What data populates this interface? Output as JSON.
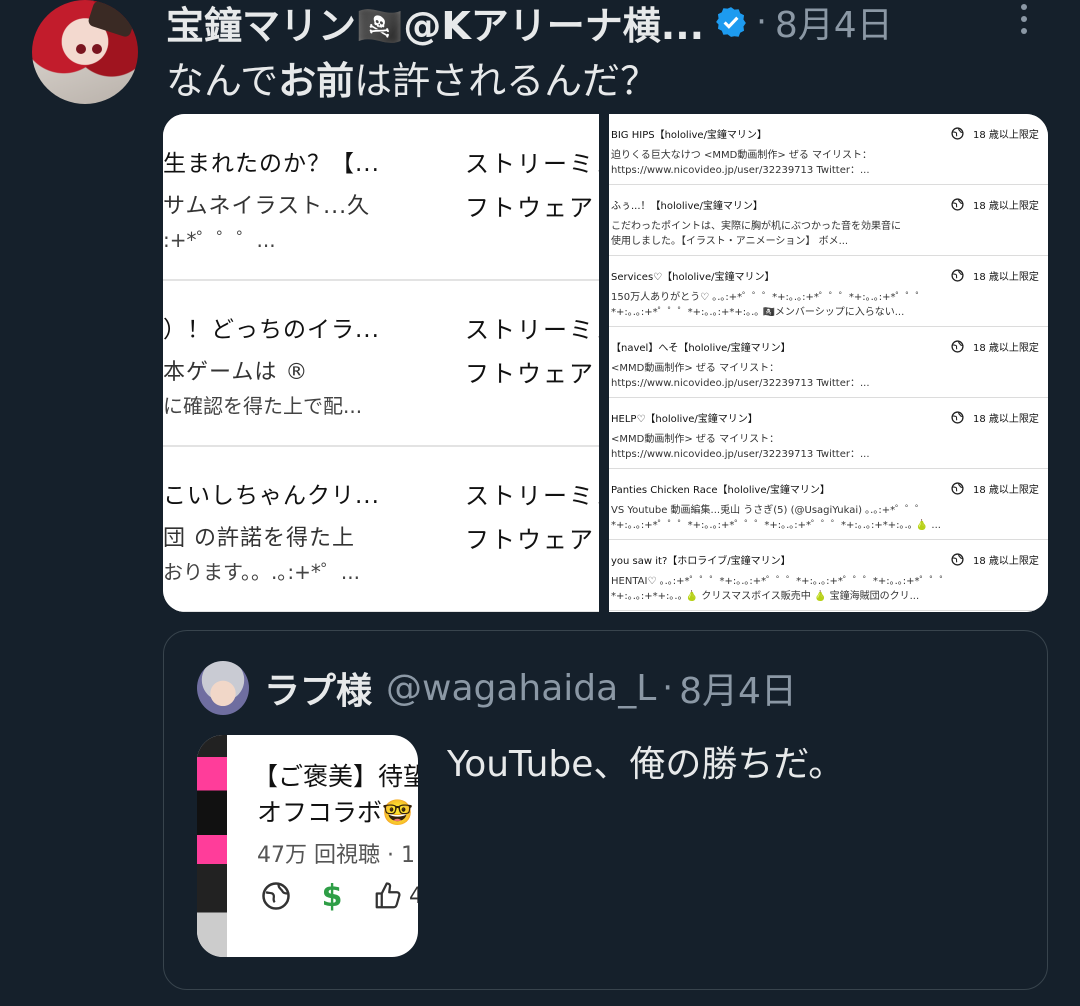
{
  "tweet": {
    "author_name": "宝鐘マリン🏴‍☠️@Kアリーナ横...",
    "date": "8月4日",
    "text_pre": "なんで",
    "text_bold": "お前",
    "text_post": "は許されるんだ？"
  },
  "media_left": [
    {
      "title": "生まれたのか？【...",
      "sub": "サムネイラスト...久",
      "sub2": ":+*゜゜゜...",
      "cat1": "ストリーミン",
      "cat2": "フトウェア"
    },
    {
      "title": "）！どっちのイラ...",
      "sub": "本ゲームは ®",
      "sub2": "に確認を得た上で配...",
      "cat1": "ストリーミン",
      "cat2": "フトウェア"
    },
    {
      "title": "こいしちゃんクリ...",
      "sub": "団 の許諾を得た上",
      "sub2": "おります。。.｡:+*゜...",
      "cat1": "ストリーミン",
      "cat2": "フトウェア"
    }
  ],
  "media_right": [
    {
      "title": "BIG HIPS【hololive/宝鐘マリン】",
      "d1": "迫りくる巨大なけつ <MMD動画制作> ぜる マイリスト：",
      "d2": "https://www.nicovideo.jp/user/32239713 Twitter：...",
      "badge": "18 歳以上限定"
    },
    {
      "title": "ふぅ...！【hololive/宝鐘マリン】",
      "d1": "こだわったポイントは、実際に胸が机にぶつかった音を効果音に",
      "d2": "使用しました。【イラスト・アニメーション】 ボメ...",
      "badge": "18 歳以上限定"
    },
    {
      "title": "Services♡【hololive/宝鐘マリン】",
      "d1": "150万人ありがとう♡ ｡.｡:+*゜゜゜*+:｡.｡:+*゜゜゜*+:｡.｡:+*゜゜゜",
      "d2": "*+:｡.｡:+*゜゜゜*+:｡.｡:+*+:｡.｡ 🏴‍☠️メンバーシップに入らない...",
      "badge": "18 歳以上限定"
    },
    {
      "title": "【navel】へそ【hololive/宝鐘マリン】",
      "d1": "<MMD動画制作> ぜる マイリスト：",
      "d2": "https://www.nicovideo.jp/user/32239713 Twitter：...",
      "badge": "18 歳以上限定"
    },
    {
      "title": "HELP♡【hololive/宝鐘マリン】",
      "d1": "<MMD動画制作> ぜる マイリスト：",
      "d2": "https://www.nicovideo.jp/user/32239713 Twitter：...",
      "badge": "18 歳以上限定"
    },
    {
      "title": "Panties Chicken Race【hololive/宝鐘マリン】",
      "d1": "VS Youtube 動画編集...兎山 うさぎ(5) (@UsagiYukai) ｡.｡:+*゜゜゜",
      "d2": "*+:｡.｡:+*゜゜゜*+:｡.｡:+*゜゜゜*+:｡.｡:+*゜゜゜*+:｡.｡:+*+:｡.｡ 🍐 ...",
      "badge": "18 歳以上限定"
    },
    {
      "title": "you saw it?【ホロライブ/宝鐘マリン】",
      "d1": "HENTAI♡ ｡.｡:+*゜゜゜*+:｡.｡:+*゜゜゜*+:｡.｡:+*゜゜゜*+:｡.｡:+*゜゜゜",
      "d2": "*+:｡.｡:+*+:｡.｡ 🍐 クリスマスボイス販売中 🍐 宝鐘海賊団のクリ...",
      "badge": "18 歳以上限定"
    }
  ],
  "quote": {
    "name": "ラプ様",
    "handle": "@wagahaida_L",
    "date": "8月4日",
    "text": "YouTube、俺の勝ちだ。",
    "thumb_title1": "【ご褒美】待望",
    "thumb_title2": "オフコラボ🤓",
    "thumb_views": "47万 回視聴 · 1",
    "thumb_count": "4"
  },
  "icons": {
    "verified": "verified-badge-icon",
    "more": "more-options-icon",
    "globe": "globe-icon",
    "dollar": "dollar-icon",
    "thumbs_up": "thumbs-up-icon"
  },
  "colors": {
    "background": "#15202b",
    "verified": "#1d9bf0",
    "muted": "#8b98a5"
  }
}
